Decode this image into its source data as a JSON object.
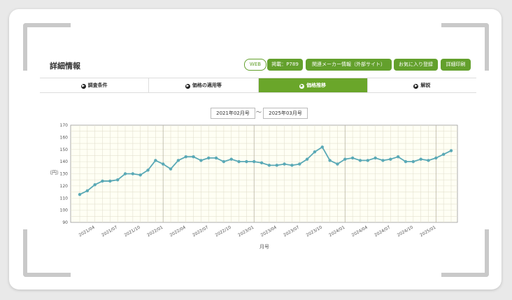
{
  "header": {
    "title": "詳細情報"
  },
  "buttons": {
    "web": "WEB",
    "page": "掲載：P789",
    "maker": "関連メーカー情報（外部サイト）",
    "favorite": "お気に入り登録",
    "print": "詳細印刷"
  },
  "tabs": [
    {
      "label": "調査条件",
      "active": false
    },
    {
      "label": "価格の適用等",
      "active": false
    },
    {
      "label": "価格推移",
      "active": true
    },
    {
      "label": "解説",
      "active": false
    }
  ],
  "range": {
    "from": "2021年02月号",
    "separator": "～",
    "to": "2025年03月号"
  },
  "colors": {
    "accent": "#63a02c",
    "line": "#5aa9b6",
    "plot_bg": "#fffff4"
  },
  "chart_data": {
    "type": "line",
    "xlabel": "月号",
    "ylabel": "（円）",
    "ylim": [
      90,
      170
    ],
    "yticks": [
      90,
      100,
      110,
      120,
      130,
      140,
      150,
      160,
      170
    ],
    "grid": true,
    "x_start": "2021/02",
    "xticks": [
      "2021/04",
      "2021/07",
      "2021/10",
      "2022/01",
      "2022/04",
      "2022/07",
      "2022/10",
      "2023/01",
      "2023/04",
      "2023/07",
      "2023/10",
      "2024/01",
      "2024/04",
      "2024/07",
      "2024/10",
      "2025/01"
    ],
    "series": [
      {
        "values": [
          113,
          116,
          121,
          124,
          124,
          125,
          130,
          130,
          129,
          133,
          141,
          138,
          134,
          141,
          144,
          144,
          141,
          143,
          143,
          140,
          142,
          140,
          140,
          140,
          139,
          137,
          137,
          138,
          137,
          138,
          142,
          148,
          152,
          141,
          138,
          142,
          143,
          141,
          141,
          143,
          141,
          142,
          144,
          140,
          140,
          142,
          141,
          143,
          146,
          149
        ]
      }
    ]
  }
}
